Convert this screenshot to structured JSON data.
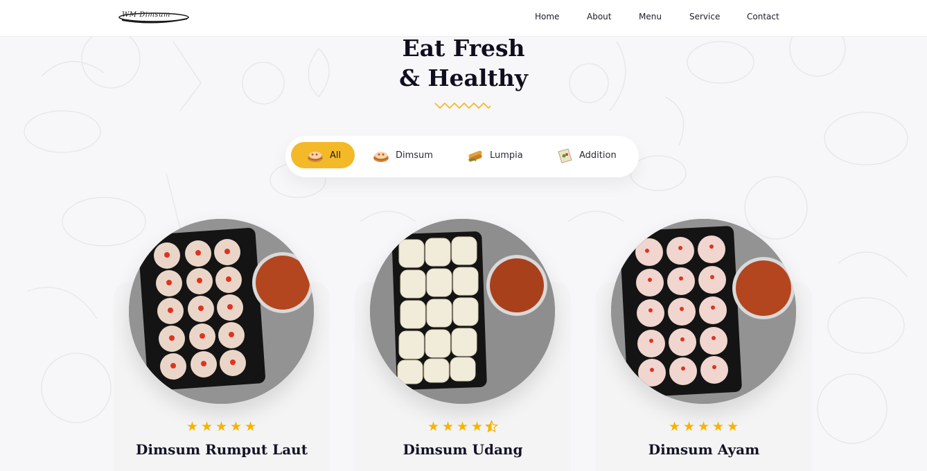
{
  "header": {
    "logo_text": "WM Dimsum",
    "nav": [
      "Home",
      "About",
      "Menu",
      "Service",
      "Contact"
    ]
  },
  "hero": {
    "title_line1": "Eat Fresh",
    "title_line2": "& Healthy"
  },
  "filters": [
    {
      "label": "All",
      "icon": "dimsum-bowl-icon",
      "active": true
    },
    {
      "label": "Dimsum",
      "icon": "dimsum-bowl-icon",
      "active": false
    },
    {
      "label": "Lumpia",
      "icon": "spring-roll-icon",
      "active": false
    },
    {
      "label": "Addition",
      "icon": "wrap-icon",
      "active": false
    }
  ],
  "products": [
    {
      "name": "Dimsum Rumput Laut",
      "rating": 5
    },
    {
      "name": "Dimsum Udang",
      "rating": 4.5
    },
    {
      "name": "Dimsum Ayam",
      "rating": 5
    }
  ],
  "colors": {
    "accent": "#f4b928",
    "star": "#f5b400",
    "title": "#0f0e1f",
    "background": "#f7f7f9"
  }
}
